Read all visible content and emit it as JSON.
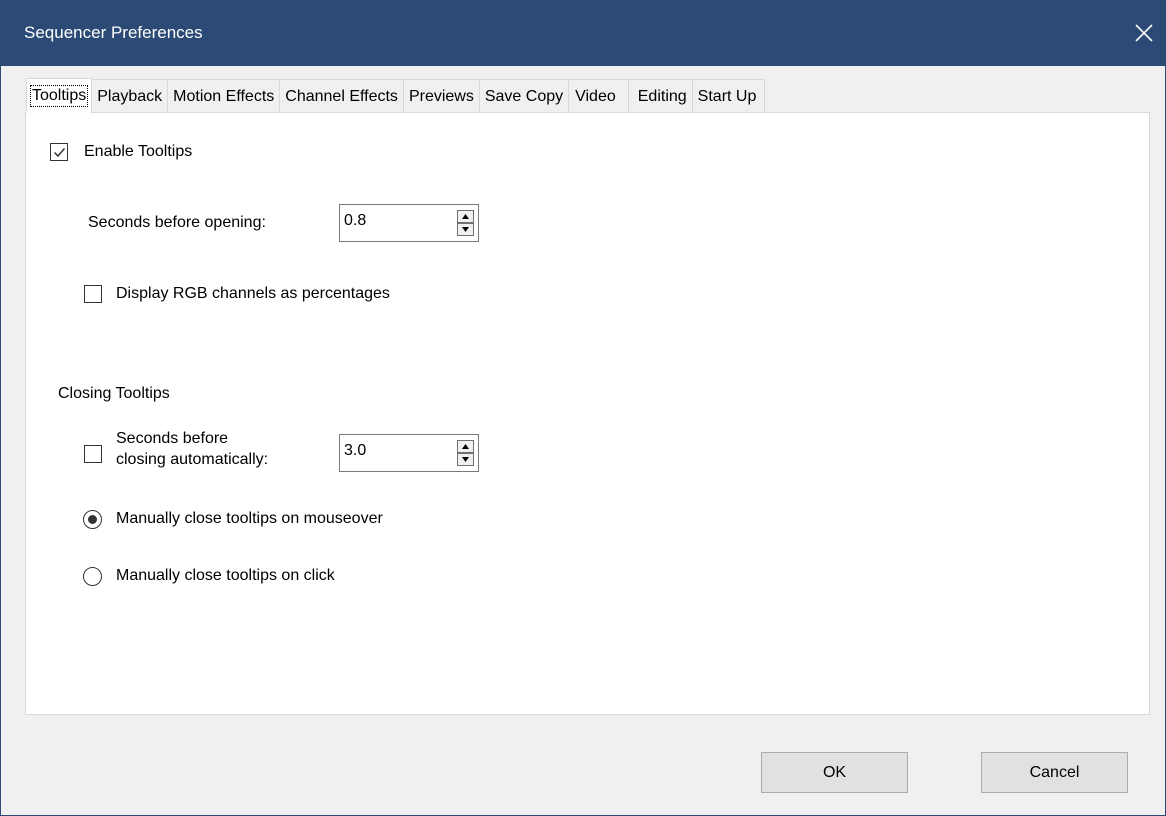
{
  "window": {
    "title": "Sequencer Preferences"
  },
  "tabs": [
    {
      "label": "Tooltips",
      "active": true
    },
    {
      "label": "Playback"
    },
    {
      "label": "Motion Effects"
    },
    {
      "label": "Channel Effects"
    },
    {
      "label": "Previews"
    },
    {
      "label": "Save Copy"
    },
    {
      "label": "Video"
    },
    {
      "label": "Editing"
    },
    {
      "label": "Start Up"
    }
  ],
  "tooltips": {
    "enable_label": "Enable Tooltips",
    "enable_checked": true,
    "open_delay_label": "Seconds before opening:",
    "open_delay_value": "0.8",
    "rgb_percent_label": "Display RGB channels as percentages",
    "rgb_percent_checked": false,
    "closing_heading": "Closing Tooltips",
    "auto_close_label_line1": "Seconds before",
    "auto_close_label_line2": "closing automatically:",
    "auto_close_checked": false,
    "auto_close_value": "3.0",
    "mouseover_label": "Manually close tooltips on mouseover",
    "mouseover_selected": true,
    "click_label": "Manually close tooltips on click",
    "click_selected": false
  },
  "buttons": {
    "ok": "OK",
    "cancel": "Cancel"
  },
  "icons": {
    "close": "close-icon",
    "check": "checkmark-icon",
    "spin_up": "arrow-up-icon",
    "spin_down": "arrow-down-icon"
  },
  "colors": {
    "titlebar": "#2b4a75",
    "panel": "#ffffff",
    "dialog": "#f0f0f0"
  }
}
